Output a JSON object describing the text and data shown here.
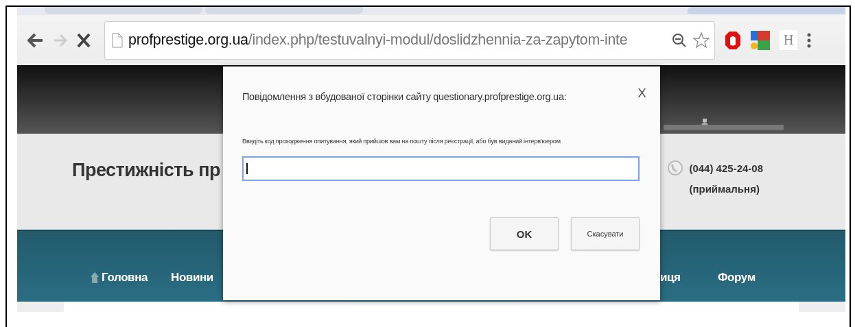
{
  "browser": {
    "address_host": "profprestige.org.ua",
    "address_path": "/index.php/testuvalnyi-modul/doslidzhennia-za-zapytom-inte",
    "forward_disabled": true,
    "extension_letter": "H"
  },
  "site": {
    "title": "Престижність пр",
    "phone": "(044) 425-24-08",
    "phone_note": "(приймальня)",
    "nav": [
      {
        "label": "Головна",
        "kind": "home"
      },
      {
        "label": "Новини",
        "kind": "plain"
      },
      {
        "label": "иця",
        "kind": "plain"
      },
      {
        "label": "Форум",
        "kind": "plain"
      }
    ]
  },
  "dialog": {
    "title": "Повідомлення з вбудованої сторінки сайту questionary.profprestige.org.ua:",
    "close": "X",
    "prompt": "Введіть код проходження опитування, який прийшов вам на пошту після реєстрації, або був виданий інтерв'юером",
    "input_focused": true,
    "buttons": [
      {
        "label": "OK",
        "kind": "primary"
      },
      {
        "label": "Скасувати",
        "kind": "secondary"
      }
    ]
  }
}
